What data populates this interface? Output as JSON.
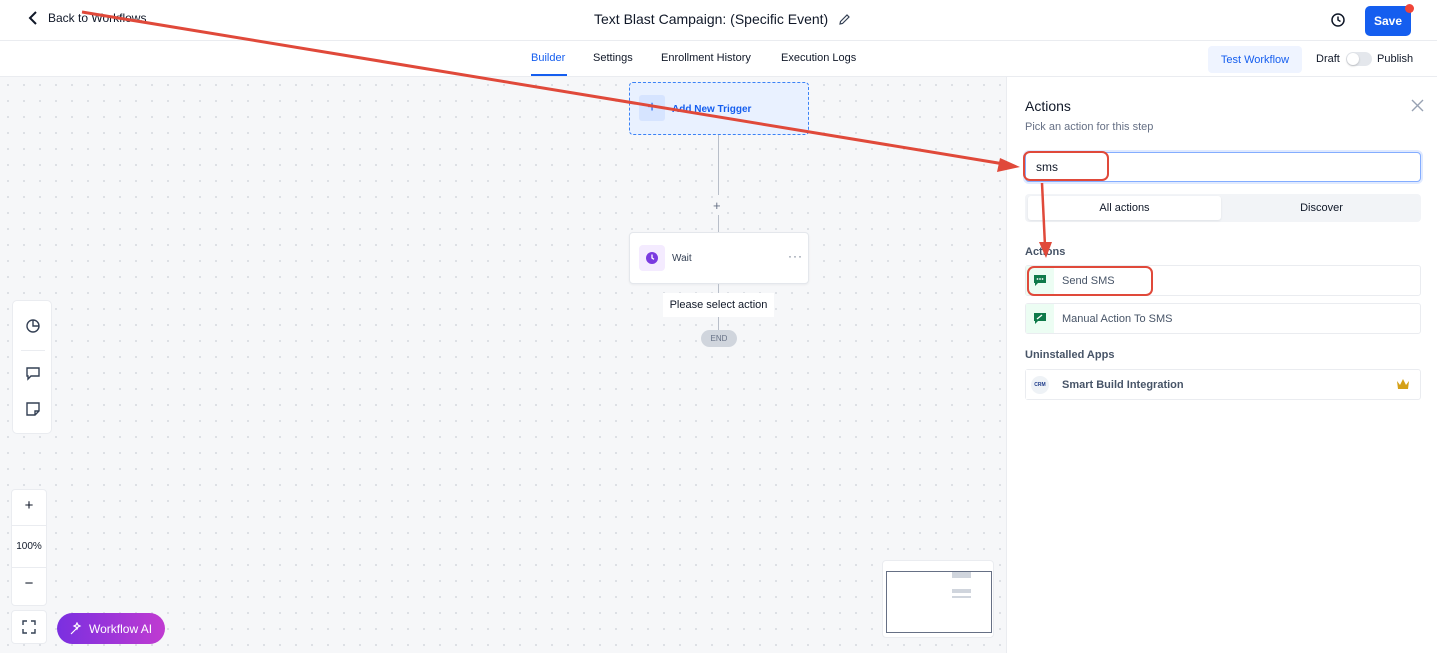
{
  "header": {
    "back_label": "Back to Workflows",
    "title": "Text Blast Campaign: (Specific Event)",
    "save_label": "Save"
  },
  "tabs": [
    {
      "label": "Builder",
      "active": true
    },
    {
      "label": "Settings",
      "active": false
    },
    {
      "label": "Enrollment History",
      "active": false
    },
    {
      "label": "Execution Logs",
      "active": false
    }
  ],
  "toolbar": {
    "test_label": "Test Workflow",
    "draft_label": "Draft",
    "publish_label": "Publish",
    "publish_on": false
  },
  "canvas": {
    "trigger_label": "Add New Trigger",
    "add_step_symbol": "+",
    "wait_label": "Wait",
    "more_symbol": "···",
    "select_action_label": "Please select action",
    "end_label": "END",
    "zoom_in": "+",
    "zoom_level": "100%",
    "zoom_out": "−",
    "ai_label": "Workflow AI"
  },
  "panel": {
    "title": "Actions",
    "subtitle": "Pick an action for this step",
    "search_value": "sms",
    "segments": [
      "All actions",
      "Discover"
    ],
    "active_segment": "All actions",
    "actions_heading": "Actions",
    "actions": [
      {
        "label": "Send SMS",
        "icon": "sms-icon"
      },
      {
        "label": "Manual Action To SMS",
        "icon": "manual-sms-icon"
      }
    ],
    "uninstalled_heading": "Uninstalled Apps",
    "uninstalled": [
      {
        "label": "Smart Build Integration",
        "logo_text": "CRM",
        "icon": "crown-icon"
      }
    ]
  },
  "colors": {
    "primary": "#155eef",
    "annotation": "#e0493a",
    "sms_green": "#0f7a4a",
    "wait_purple": "#7a3ae0"
  }
}
